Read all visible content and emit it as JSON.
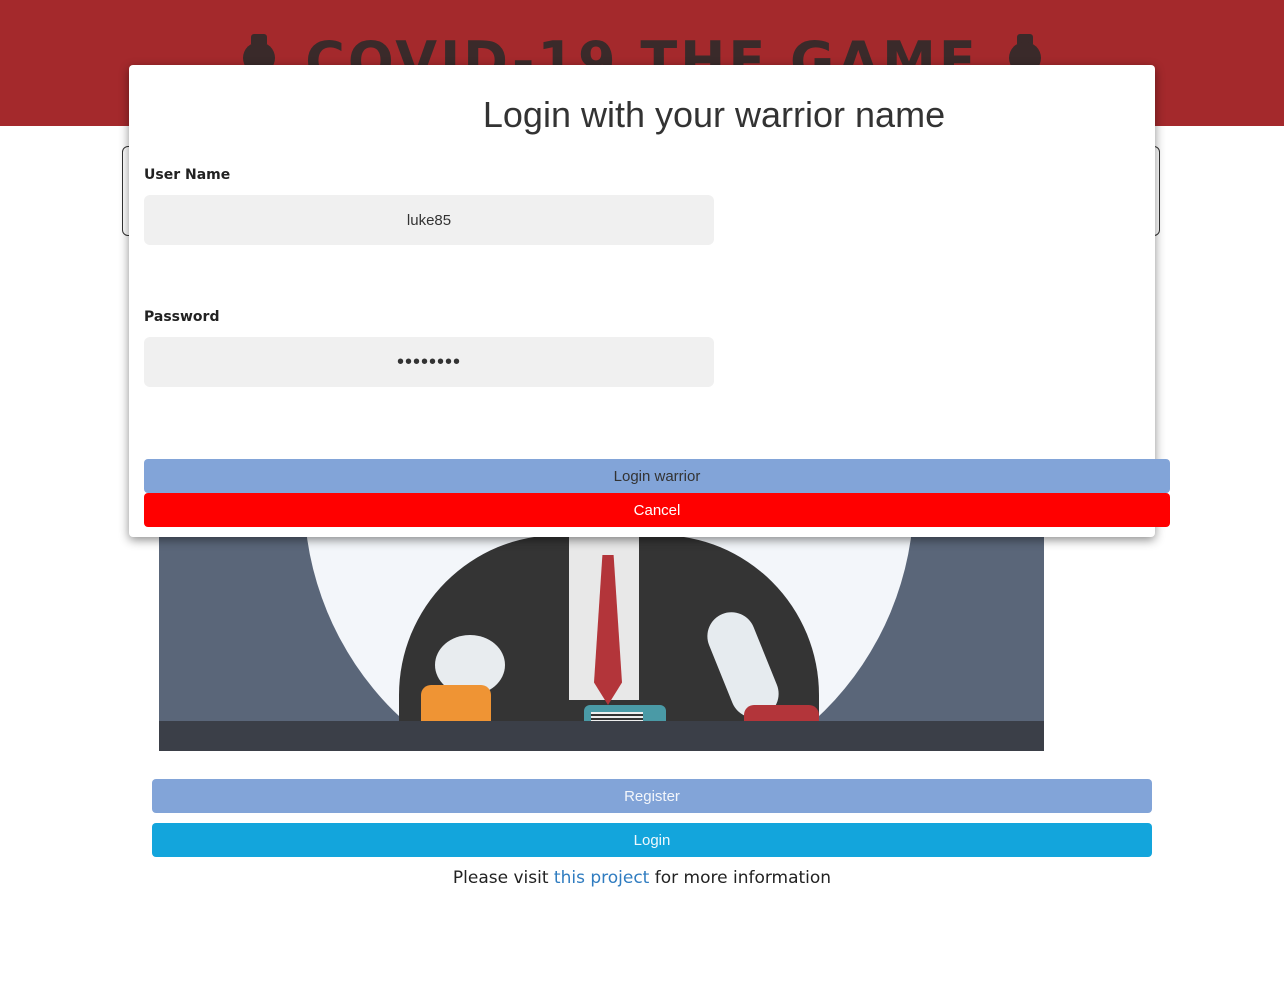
{
  "header": {
    "title": "COVID-19 THE GAME",
    "icon_left": "flask-icon",
    "icon_right": "flask-icon",
    "background_color": "#a4292c"
  },
  "main": {
    "register_label": "Register",
    "login_label": "Login",
    "footer": {
      "prefix": "Please visit",
      "link_text": "this project",
      "suffix": "for more information"
    }
  },
  "modal": {
    "title": "Login with your warrior name",
    "username": {
      "label": "User Name",
      "value": "luke85"
    },
    "password": {
      "label": "Password",
      "value": "••••••••"
    },
    "login_button": "Login warrior",
    "cancel_button": "Cancel"
  },
  "colors": {
    "register_button": "#82a4d8",
    "login_button": "#13a5dc",
    "cancel_button": "#ff0000",
    "link": "#2f7cc0"
  }
}
